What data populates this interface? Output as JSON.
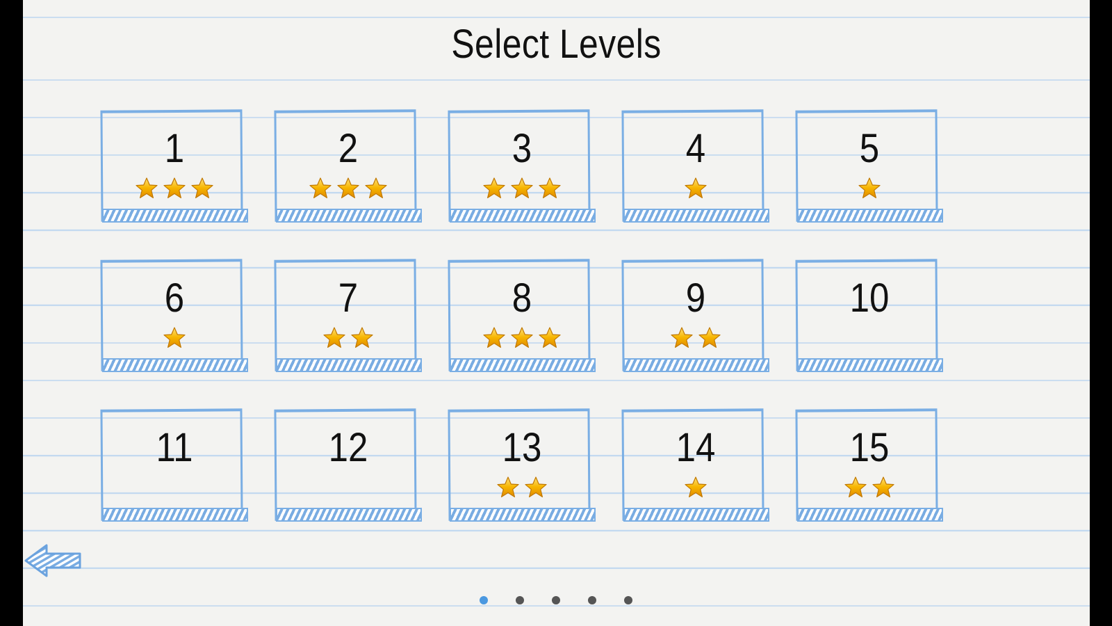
{
  "title": "Select Levels",
  "levels": [
    {
      "label": "1",
      "stars": 3
    },
    {
      "label": "2",
      "stars": 3
    },
    {
      "label": "3",
      "stars": 3
    },
    {
      "label": "4",
      "stars": 1
    },
    {
      "label": "5",
      "stars": 1
    },
    {
      "label": "6",
      "stars": 1
    },
    {
      "label": "7",
      "stars": 2
    },
    {
      "label": "8",
      "stars": 3
    },
    {
      "label": "9",
      "stars": 2
    },
    {
      "label": "10",
      "stars": 0
    },
    {
      "label": "11",
      "stars": 0
    },
    {
      "label": "12",
      "stars": 0
    },
    {
      "label": "13",
      "stars": 2
    },
    {
      "label": "14",
      "stars": 1
    },
    {
      "label": "15",
      "stars": 2
    }
  ],
  "back_icon": "back-arrow-icon",
  "pagination": {
    "pages": 5,
    "current": 1
  },
  "colors": {
    "tile_border": "#7aaee4",
    "star": "#f7b500",
    "active_dot": "#4a98e0",
    "inactive_dot": "#555555"
  }
}
